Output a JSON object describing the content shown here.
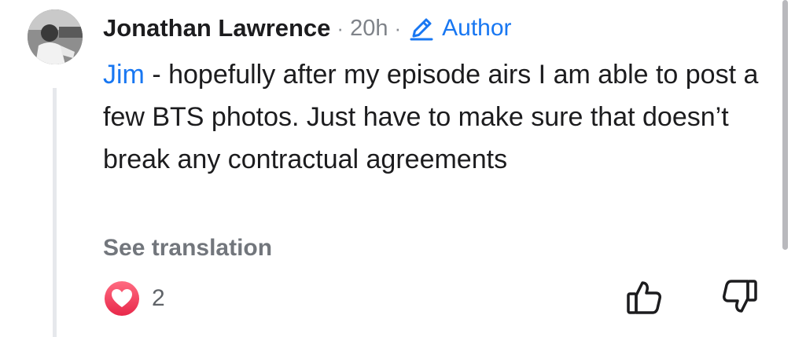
{
  "comment": {
    "author_name": "Jonathan Lawrence",
    "separator": "·",
    "timestamp": "20h",
    "author_badge": "Author",
    "mention": "Jim",
    "text": " - hopefully after my episode airs I am able to post a few BTS photos. Just have to make sure that doesn’t break any contractual agreements",
    "see_translation": "See translation",
    "reaction_count": "2"
  },
  "icons": {
    "avatar": "avatar",
    "author_badge": "pencil-icon",
    "reaction": "heart-reaction-icon",
    "upvote": "thumbs-up-icon",
    "downvote": "thumbs-down-icon"
  },
  "colors": {
    "link": "#1877f2",
    "reaction_heart": "#f3425f",
    "muted_text": "#72767c"
  }
}
